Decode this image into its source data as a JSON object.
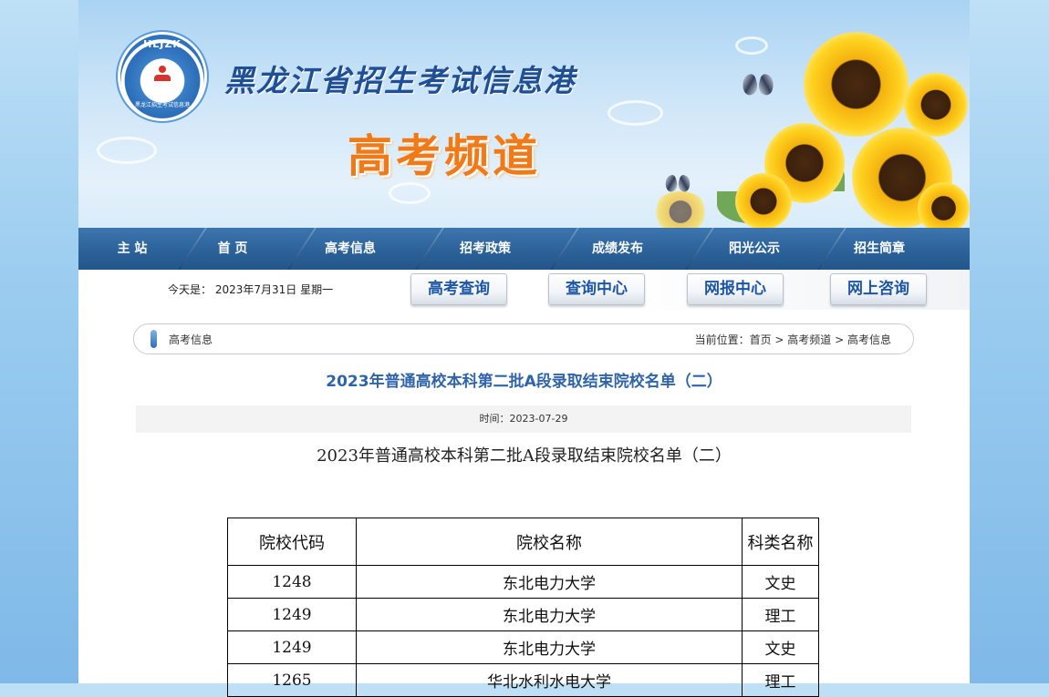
{
  "banner": {
    "logo_text": "HLJZK",
    "logo_subtext": "黑龙江招生考试信息港",
    "site_title": "黑龙江省招生考试信息港",
    "channel_title": "高考频道"
  },
  "nav": {
    "items": [
      "主 站",
      "首 页",
      "高考信息",
      "招考政策",
      "成绩发布",
      "阳光公示",
      "招生简章"
    ]
  },
  "toolbar": {
    "date_text": "今天是： 2023年7月31日 星期一",
    "buttons": [
      "高考查询",
      "查询中心",
      "网报中心",
      "网上咨询"
    ]
  },
  "breadcrumb": {
    "section": "高考信息",
    "prefix": "当前位置：",
    "path": [
      "首页",
      "高考频道",
      "高考信息"
    ],
    "separator": " > "
  },
  "article": {
    "title": "2023年普通高校本科第二批A段录取结束院校名单（二）",
    "meta": "时间：2023-07-29",
    "subtitle": "2023年普通高校本科第二批A段录取结束院校名单（二）"
  },
  "table": {
    "headers": [
      "院校代码",
      "院校名称",
      "科类名称"
    ],
    "rows": [
      [
        "1248",
        "东北电力大学",
        "文史"
      ],
      [
        "1249",
        "东北电力大学",
        "理工"
      ],
      [
        "1249",
        "东北电力大学",
        "文史"
      ],
      [
        "1265",
        "华北水利水电大学",
        "理工"
      ]
    ]
  },
  "colors": {
    "nav_bg": "#2c6299",
    "title_blue": "#2f65a8",
    "channel_orange": "#f07a18",
    "button_text": "#1e56a6"
  }
}
